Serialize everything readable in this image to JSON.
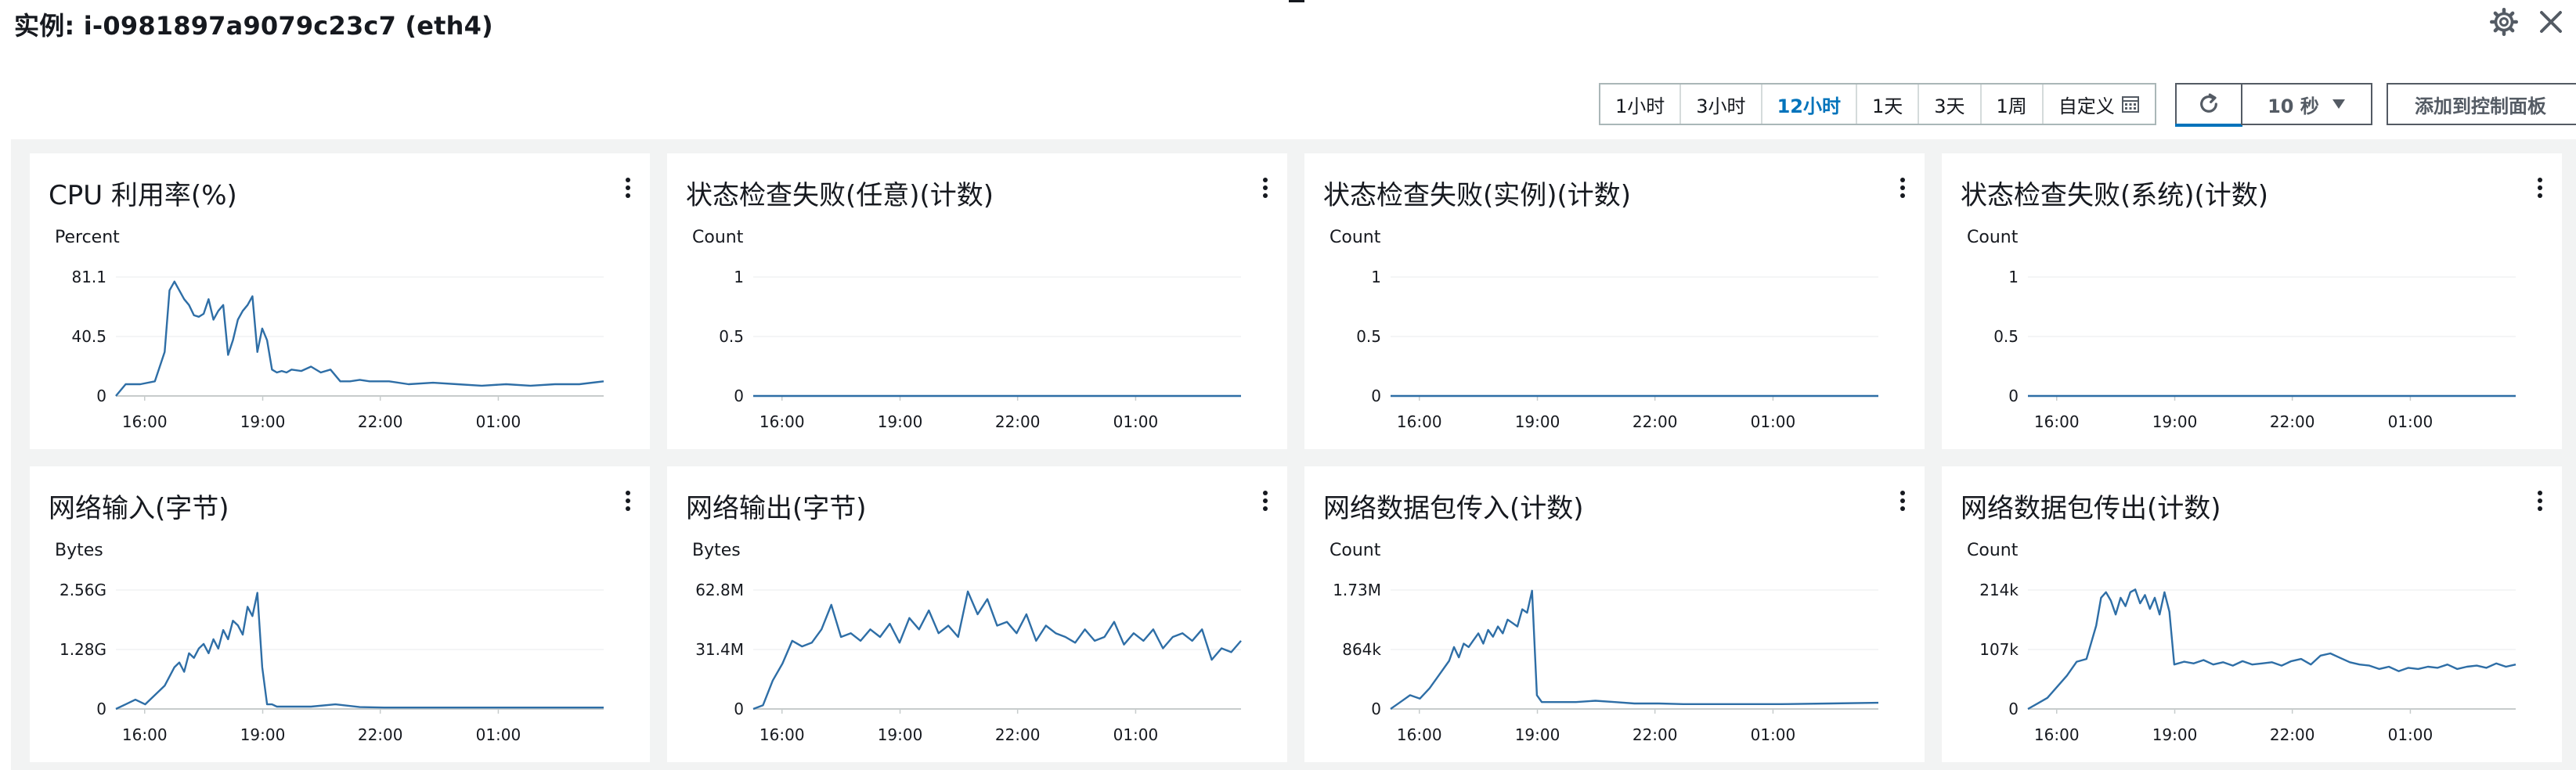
{
  "header": {
    "title": "实例: i-0981897a9079c23c7 (eth4)"
  },
  "toolbar": {
    "ranges": [
      "1小时",
      "3小时",
      "12小时",
      "1天",
      "3天",
      "1周",
      "自定义"
    ],
    "active_range": "12小时",
    "interval_label": "10 秒",
    "add_label": "添加到控制面板"
  },
  "colors": {
    "line": "#2e6ea6",
    "accent": "#0073bb",
    "panel_bg": "#f2f3f3"
  },
  "icons": [
    "gear-icon",
    "close-icon",
    "calendar-icon",
    "refresh-icon",
    "caret-down-icon",
    "kebab-menu-icon"
  ],
  "charts": [
    {
      "title": "CPU 利用率(%)",
      "unit": "Percent",
      "yticks": [
        "81.1",
        "40.5",
        "0"
      ],
      "xticks": [
        "16:00",
        "19:00",
        "22:00",
        "01:00"
      ],
      "chart_data": {
        "type": "line",
        "ylim": [
          0,
          81.1
        ],
        "x": [
          0,
          2,
          5,
          8,
          10,
          11,
          12,
          13,
          14,
          15,
          16,
          17,
          18,
          19,
          20,
          21,
          22,
          23,
          24,
          25,
          26,
          27,
          28,
          29,
          30,
          31,
          32,
          33,
          34,
          35,
          36,
          38,
          40,
          42,
          44,
          46,
          48,
          50,
          52,
          56,
          60,
          65,
          70,
          75,
          80,
          85,
          90,
          95,
          100
        ],
        "values": [
          0,
          8,
          8,
          10,
          30,
          72,
          78,
          72,
          66,
          62,
          55,
          54,
          56,
          66,
          52,
          58,
          62,
          28,
          38,
          52,
          58,
          62,
          68,
          30,
          46,
          38,
          18,
          16,
          17,
          16,
          18,
          17,
          20,
          16,
          18,
          10,
          10,
          11,
          10,
          10,
          8,
          9,
          8,
          7,
          8,
          7,
          8,
          8,
          10
        ]
      }
    },
    {
      "title": "状态检查失败(任意)(计数)",
      "unit": "Count",
      "yticks": [
        "1",
        "0.5",
        "0"
      ],
      "xticks": [
        "16:00",
        "19:00",
        "22:00",
        "01:00"
      ],
      "chart_data": {
        "type": "line",
        "ylim": [
          0,
          1
        ],
        "x": [
          0,
          100
        ],
        "values": [
          0,
          0
        ]
      }
    },
    {
      "title": "状态检查失败(实例)(计数)",
      "unit": "Count",
      "yticks": [
        "1",
        "0.5",
        "0"
      ],
      "xticks": [
        "16:00",
        "19:00",
        "22:00",
        "01:00"
      ],
      "chart_data": {
        "type": "line",
        "ylim": [
          0,
          1
        ],
        "x": [
          0,
          100
        ],
        "values": [
          0,
          0
        ]
      }
    },
    {
      "title": "状态检查失败(系统)(计数)",
      "unit": "Count",
      "yticks": [
        "1",
        "0.5",
        "0"
      ],
      "xticks": [
        "16:00",
        "19:00",
        "22:00",
        "01:00"
      ],
      "chart_data": {
        "type": "line",
        "ylim": [
          0,
          1
        ],
        "x": [
          0,
          100
        ],
        "values": [
          0,
          0
        ]
      }
    },
    {
      "title": "网络输入(字节)",
      "unit": "Bytes",
      "yticks": [
        "2.56G",
        "1.28G",
        "0"
      ],
      "xticks": [
        "16:00",
        "19:00",
        "22:00",
        "01:00"
      ],
      "chart_data": {
        "type": "line",
        "ylim": [
          0,
          2.56
        ],
        "x": [
          0,
          2,
          4,
          6,
          8,
          10,
          12,
          13,
          14,
          15,
          16,
          17,
          18,
          19,
          20,
          21,
          22,
          23,
          24,
          25,
          26,
          27,
          28,
          29,
          30,
          31,
          32,
          33,
          34,
          36,
          40,
          45,
          50,
          55,
          60,
          70,
          80,
          90,
          100
        ],
        "values": [
          0,
          0.1,
          0.2,
          0.1,
          0.3,
          0.5,
          0.9,
          1.0,
          0.8,
          1.2,
          1.1,
          1.3,
          1.4,
          1.2,
          1.5,
          1.3,
          1.7,
          1.5,
          1.9,
          1.8,
          1.6,
          2.2,
          2.0,
          2.5,
          0.9,
          0.1,
          0.1,
          0.05,
          0.05,
          0.05,
          0.05,
          0.1,
          0.04,
          0.03,
          0.03,
          0.03,
          0.03,
          0.03,
          0.03
        ]
      }
    },
    {
      "title": "网络输出(字节)",
      "unit": "Bytes",
      "yticks": [
        "62.8M",
        "31.4M",
        "0"
      ],
      "xticks": [
        "16:00",
        "19:00",
        "22:00",
        "01:00"
      ],
      "chart_data": {
        "type": "line",
        "ylim": [
          0,
          62.8
        ],
        "x": [
          0,
          2,
          4,
          6,
          8,
          10,
          12,
          14,
          16,
          18,
          20,
          22,
          24,
          26,
          28,
          30,
          32,
          34,
          36,
          38,
          40,
          42,
          44,
          46,
          48,
          50,
          52,
          54,
          56,
          58,
          60,
          62,
          64,
          66,
          68,
          70,
          72,
          74,
          76,
          78,
          80,
          82,
          84,
          86,
          88,
          90,
          92,
          94,
          96,
          98,
          100
        ],
        "values": [
          0,
          2,
          15,
          24,
          36,
          33,
          35,
          42,
          55,
          38,
          40,
          36,
          42,
          38,
          45,
          35,
          48,
          42,
          52,
          40,
          44,
          38,
          62,
          50,
          58,
          44,
          46,
          40,
          50,
          36,
          44,
          40,
          38,
          35,
          42,
          36,
          38,
          46,
          34,
          40,
          36,
          42,
          32,
          38,
          40,
          36,
          42,
          26,
          32,
          30,
          36
        ]
      }
    },
    {
      "title": "网络数据包传入(计数)",
      "unit": "Count",
      "yticks": [
        "1.73M",
        "864k",
        "0"
      ],
      "xticks": [
        "16:00",
        "19:00",
        "22:00",
        "01:00"
      ],
      "chart_data": {
        "type": "line",
        "ylim": [
          0,
          1.73
        ],
        "x": [
          0,
          2,
          4,
          6,
          8,
          10,
          12,
          13,
          14,
          15,
          16,
          17,
          18,
          19,
          20,
          21,
          22,
          23,
          24,
          25,
          26,
          27,
          28,
          29,
          30,
          31,
          32,
          34,
          38,
          42,
          46,
          50,
          55,
          60,
          70,
          80,
          90,
          100
        ],
        "values": [
          0,
          0.1,
          0.2,
          0.15,
          0.3,
          0.5,
          0.7,
          0.9,
          0.75,
          0.95,
          0.9,
          1.0,
          1.1,
          0.95,
          1.15,
          1.05,
          1.2,
          1.1,
          1.3,
          1.25,
          1.2,
          1.45,
          1.4,
          1.72,
          0.2,
          0.1,
          0.1,
          0.1,
          0.1,
          0.12,
          0.1,
          0.08,
          0.08,
          0.07,
          0.07,
          0.07,
          0.08,
          0.09
        ]
      }
    },
    {
      "title": "网络数据包传出(计数)",
      "unit": "Count",
      "yticks": [
        "214k",
        "107k",
        "0"
      ],
      "xticks": [
        "16:00",
        "19:00",
        "22:00",
        "01:00"
      ],
      "chart_data": {
        "type": "line",
        "ylim": [
          0,
          214
        ],
        "x": [
          0,
          2,
          4,
          6,
          8,
          10,
          12,
          13,
          14,
          15,
          16,
          17,
          18,
          19,
          20,
          21,
          22,
          23,
          24,
          25,
          26,
          27,
          28,
          29,
          30,
          32,
          34,
          36,
          38,
          40,
          42,
          44,
          46,
          48,
          50,
          52,
          54,
          56,
          58,
          60,
          62,
          64,
          66,
          68,
          70,
          72,
          74,
          76,
          78,
          80,
          82,
          84,
          86,
          88,
          90,
          92,
          94,
          96,
          98,
          100
        ],
        "values": [
          0,
          10,
          20,
          40,
          60,
          85,
          90,
          120,
          150,
          200,
          210,
          195,
          170,
          200,
          185,
          210,
          215,
          190,
          205,
          180,
          200,
          170,
          210,
          175,
          80,
          85,
          82,
          88,
          80,
          84,
          78,
          86,
          80,
          82,
          84,
          78,
          86,
          90,
          80,
          96,
          100,
          92,
          84,
          80,
          78,
          72,
          76,
          68,
          74,
          72,
          76,
          74,
          80,
          72,
          76,
          78,
          74,
          82,
          76,
          80
        ]
      }
    }
  ]
}
